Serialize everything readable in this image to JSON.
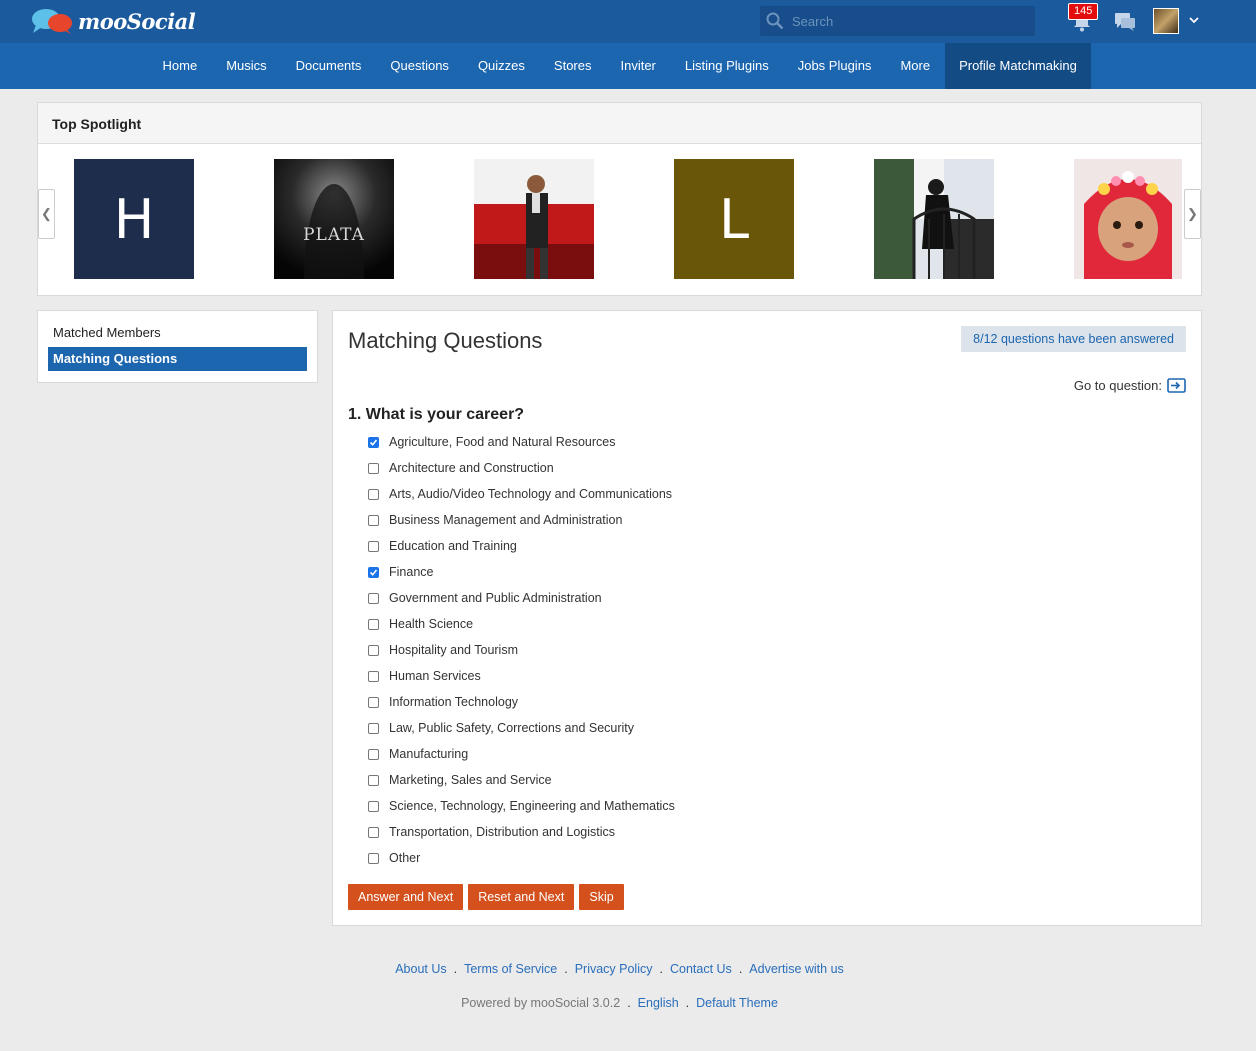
{
  "header": {
    "logo_text": "mooSocial",
    "search_placeholder": "Search",
    "notification_count": "145"
  },
  "nav": {
    "items": [
      "Home",
      "Musics",
      "Documents",
      "Questions",
      "Quizzes",
      "Stores",
      "Inviter",
      "Listing Plugins",
      "Jobs Plugins",
      "More",
      "Profile Matchmaking"
    ],
    "active_index": 10
  },
  "spotlight": {
    "title": "Top Spotlight",
    "prev_glyph": "❮",
    "next_glyph": "❯",
    "members": [
      {
        "type": "letter",
        "letter": "H",
        "bg": "#1e2d4c"
      },
      {
        "type": "photo",
        "label": "PLATA"
      },
      {
        "type": "photo"
      },
      {
        "type": "letter",
        "letter": "L",
        "bg": "#6a5608"
      },
      {
        "type": "photo"
      },
      {
        "type": "photo"
      }
    ]
  },
  "sidebar": {
    "items": [
      {
        "label": "Matched Members",
        "active": false
      },
      {
        "label": "Matching Questions",
        "active": true
      }
    ]
  },
  "main": {
    "title": "Matching Questions",
    "progress_text": "8/12 questions have been answered",
    "goto_label": "Go to question:",
    "question_title": "1. What is your career?",
    "options": [
      {
        "label": "Agriculture, Food and Natural Resources",
        "checked": true
      },
      {
        "label": "Architecture and Construction",
        "checked": false
      },
      {
        "label": "Arts, Audio/Video Technology and Communications",
        "checked": false
      },
      {
        "label": "Business Management and Administration",
        "checked": false
      },
      {
        "label": "Education and Training",
        "checked": false
      },
      {
        "label": "Finance",
        "checked": true
      },
      {
        "label": "Government and Public Administration",
        "checked": false
      },
      {
        "label": "Health Science",
        "checked": false
      },
      {
        "label": "Hospitality and Tourism",
        "checked": false
      },
      {
        "label": "Human Services",
        "checked": false
      },
      {
        "label": "Information Technology",
        "checked": false
      },
      {
        "label": "Law, Public Safety, Corrections and Security",
        "checked": false
      },
      {
        "label": "Manufacturing",
        "checked": false
      },
      {
        "label": "Marketing, Sales and Service",
        "checked": false
      },
      {
        "label": "Science, Technology, Engineering and Mathematics",
        "checked": false
      },
      {
        "label": "Transportation, Distribution and Logistics",
        "checked": false
      },
      {
        "label": "Other",
        "checked": false
      }
    ],
    "buttons": {
      "answer_next": "Answer and Next",
      "reset_next": "Reset and Next",
      "skip": "Skip"
    }
  },
  "footer": {
    "links": [
      "About Us",
      "Terms of Service",
      "Privacy Policy",
      "Contact Us",
      "Advertise with us"
    ],
    "separator": ".",
    "powered_by": "Powered by mooSocial 3.0.2",
    "language": "English",
    "theme": "Default Theme"
  },
  "colors": {
    "header_bg": "#1c5a9e",
    "nav_bg": "#1c66b0",
    "accent_button": "#d4501d",
    "link": "#2a6ebb"
  }
}
